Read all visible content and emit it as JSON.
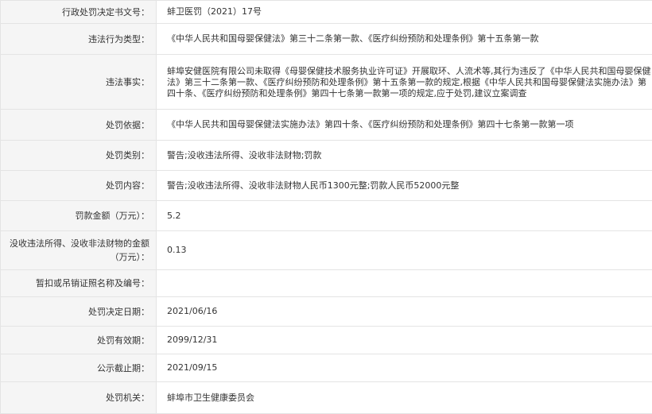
{
  "rows": [
    {
      "label": "行政处罚决定书文号：",
      "value": "蚌卫医罚（2021）17号"
    },
    {
      "label": "违法行为类型：",
      "value": "《中华人民共和国母婴保健法》第三十二条第一款、《医疗纠纷预防和处理条例》第十五条第一款"
    },
    {
      "label": "违法事实：",
      "value": "蚌埠安健医院有限公司未取得《母婴保健技术服务执业许可证》开展取环、人流术等,其行为违反了《中华人民共和国母婴保健法》第三十二条第一款、《医疗纠纷预防和处理条例》第十五条第一款的规定,根据《中华人民共和国母婴保健法实施办法》第四十条、《医疗纠纷预防和处理条例》第四十七条第一款第一项的规定,应于处罚,建议立案调查"
    },
    {
      "label": "处罚依据：",
      "value": "《中华人民共和国母婴保健法实施办法》第四十条、《医疗纠纷预防和处理条例》第四十七条第一款第一项"
    },
    {
      "label": "处罚类别：",
      "value": "警告;没收违法所得、没收非法财物;罚款"
    },
    {
      "label": "处罚内容：",
      "value": "警告;没收违法所得、没收非法财物人民币1300元整;罚款人民币52000元整"
    },
    {
      "label": "罚款金额（万元）：",
      "value": "5.2"
    },
    {
      "label": "没收违法所得、没收非法财物的金额（万元）：",
      "value": "0.13"
    },
    {
      "label": "暂扣或吊销证照名称及编号：",
      "value": ""
    },
    {
      "label": "处罚决定日期：",
      "value": "2021/06/16"
    },
    {
      "label": "处罚有效期：",
      "value": "2099/12/31"
    },
    {
      "label": "公示截止期：",
      "value": "2021/09/15"
    },
    {
      "label": "处罚机关：",
      "value": "蚌埠市卫生健康委员会"
    }
  ]
}
